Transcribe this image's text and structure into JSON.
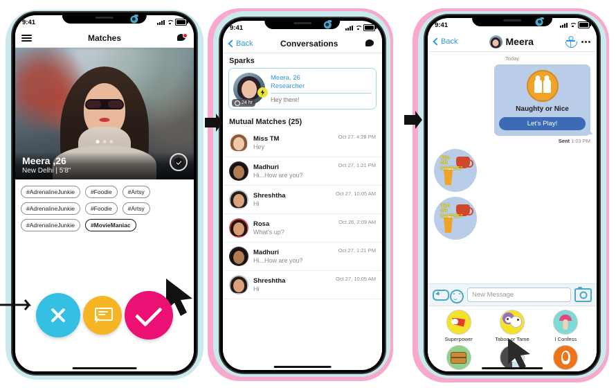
{
  "phone1": {
    "status": {
      "time": "9:41"
    },
    "nav": {
      "menu_icon": "hamburger-icon",
      "title": "Matches",
      "chat_icon": "chat-bubble-icon"
    },
    "profile": {
      "name": "Meera ,26",
      "details": "New Delhi | 5'8\"",
      "verified_icon": "verified-shield-icon",
      "carousel_count": 3,
      "carousel_active": 0
    },
    "tags": [
      "#AdrenalineJunkie",
      "#Foodie",
      "#Artsy",
      "#AdrenalineJunkie",
      "#Foodie",
      "#Artsy",
      "#AdrenalineJunkie",
      "#MovieManiac"
    ],
    "actions": [
      {
        "name": "nope-button",
        "icon": "x-icon",
        "color": "#35bfe3"
      },
      {
        "name": "spark-button",
        "icon": "spark-card-icon",
        "color": "#f6b524"
      },
      {
        "name": "like-button",
        "icon": "check-icon",
        "color": "#ec0f74"
      }
    ]
  },
  "phone2": {
    "status": {
      "time": "9:41"
    },
    "nav": {
      "back_label": "Back",
      "title": "Conversations",
      "chat_icon": "chat-bubble-icon"
    },
    "sparks": {
      "header": "Sparks",
      "name": "Meera, 26",
      "role": "Researcher",
      "message": "Hey there!",
      "timer": "24 hr",
      "badge_icon": "lightning-badge-icon"
    },
    "mutual": {
      "header": "Mutual Matches (25)",
      "items": [
        {
          "name": "Miss TM",
          "message": "Hey",
          "time": "Oct 27, 4:28 PM",
          "skin": "#f0c9a8",
          "hair": "#8a5a3c",
          "bg": "#f2efe9"
        },
        {
          "name": "Madhuri",
          "message": "Hi...How are you?",
          "time": "Oct 27, 1:21 PM",
          "skin": "#b07a52",
          "hair": "#161212",
          "bg": "#2a2222"
        },
        {
          "name": "Shreshtha",
          "message": "Hi",
          "time": "Oct 27, 10:05 AM",
          "skin": "#d9a27c",
          "hair": "#241a16",
          "bg": "#b9c6cc"
        },
        {
          "name": "Rosa",
          "message": "What's up?",
          "time": "Oct 26, 2:09 AM",
          "skin": "#d79b72",
          "hair": "#1d1512",
          "bg": "#d24a4a"
        },
        {
          "name": "Madhuri",
          "message": "Hi...How are you?",
          "time": "Oct 27, 1:21 PM",
          "skin": "#b07a52",
          "hair": "#161212",
          "bg": "#2a2222"
        },
        {
          "name": "Shreshtha",
          "message": "Hi",
          "time": "Oct 27, 10:05 AM",
          "skin": "#d9a27c",
          "hair": "#241a16",
          "bg": "#b9c6cc"
        }
      ]
    }
  },
  "phone3": {
    "status": {
      "time": "9:41"
    },
    "nav": {
      "back_label": "Back",
      "title": "Meera",
      "game_icon": "game-anchor-icon",
      "more_icon": "more-dots-icon"
    },
    "chat": {
      "day": "Today",
      "game_card": {
        "title": "Naughty or Nice",
        "button": "Let's Play!",
        "icon": "naughty-or-nice-icon"
      },
      "sent_label": "Sent",
      "sent_time": "1:03 PM",
      "stickers": [
        {
          "line1": "TEA",
          "line2": "OR",
          "line3": "COFFEE?"
        },
        {
          "line1": "TEA",
          "line2": "OR",
          "line3": "COFFEE?"
        }
      ]
    },
    "input": {
      "game_icon": "gamepad-icon",
      "emoji_icon": "smiley-icon",
      "placeholder": "New Message",
      "value": "",
      "camera_icon": "camera-icon"
    },
    "games": [
      {
        "label": "Superpower",
        "icon": "superpower-icon",
        "bg": "#f4e12a",
        "fg": "#e23b2e"
      },
      {
        "label": "Taboo or Tame",
        "icon": "taboo-or-tame-icon",
        "bg": "#f4e12a",
        "fg": "#9b6fc0"
      },
      {
        "label": "I Confess",
        "icon": "i-confess-icon",
        "bg": "#7fd9d4",
        "fg": "#e0477f"
      },
      {
        "label": "",
        "icon": "treasure-icon",
        "bg": "#8fd08a",
        "fg": "#c98a3a"
      },
      {
        "label": "",
        "icon": "dove-icon",
        "bg": "#cfe3ef",
        "fg": "#4a4a4a"
      },
      {
        "label": "",
        "icon": "penguin-icon",
        "bg": "#ef7318",
        "fg": "#ffffff"
      }
    ]
  },
  "annotations": {
    "arrow_1": "flow-arrow-right",
    "arrow_2": "flow-arrow-right",
    "cursor": "pointer-cursor"
  }
}
